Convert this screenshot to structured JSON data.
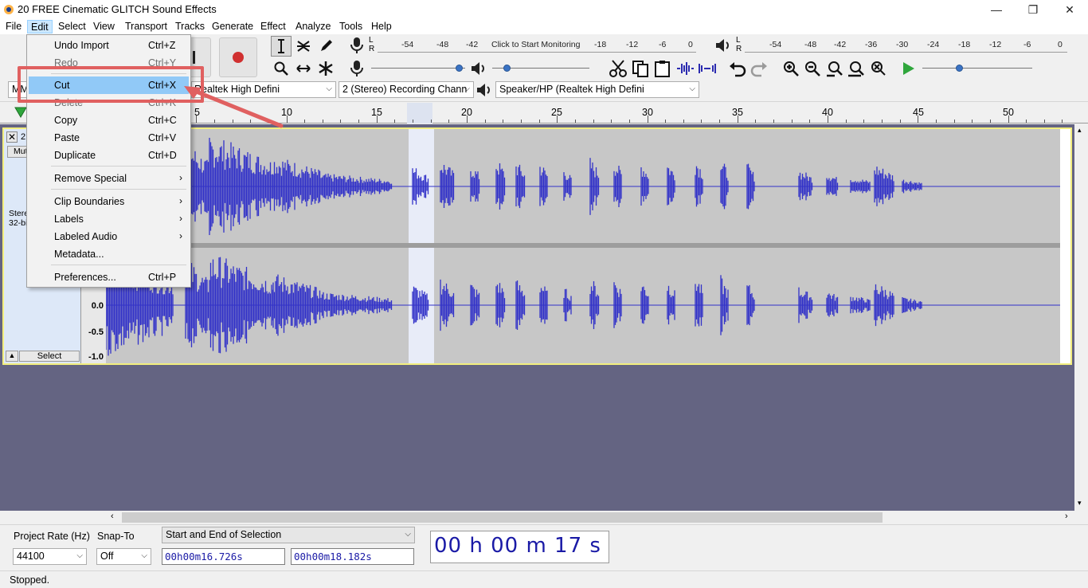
{
  "window": {
    "title": "20 FREE Cinematic GLITCH Sound Effects",
    "minimize_icon": "minimize-icon",
    "maximize_icon": "restore-icon",
    "close_icon": "close-icon"
  },
  "menubar": {
    "items": [
      "File",
      "Edit",
      "Select",
      "View",
      "Transport",
      "Tracks",
      "Generate",
      "Effect",
      "Analyze",
      "Tools",
      "Help"
    ],
    "open_menu": "Edit"
  },
  "edit_menu": {
    "items": [
      {
        "label": "Undo Import",
        "shortcut": "Ctrl+Z",
        "enabled": true
      },
      {
        "label": "Redo",
        "shortcut": "Ctrl+Y",
        "enabled": false
      },
      {
        "label": "Cut",
        "shortcut": "Ctrl+X",
        "enabled": true,
        "highlighted": true
      },
      {
        "label": "Delete",
        "shortcut": "Ctrl+K",
        "enabled": false
      },
      {
        "label": "Copy",
        "shortcut": "Ctrl+C",
        "enabled": true
      },
      {
        "label": "Paste",
        "shortcut": "Ctrl+V",
        "enabled": true
      },
      {
        "label": "Duplicate",
        "shortcut": "Ctrl+D",
        "enabled": true
      },
      {
        "label": "Remove Special",
        "shortcut": "",
        "submenu": true
      },
      {
        "label": "Clip Boundaries",
        "shortcut": "",
        "submenu": true
      },
      {
        "label": "Labels",
        "shortcut": "",
        "submenu": true
      },
      {
        "label": "Labeled Audio",
        "shortcut": "",
        "submenu": true
      },
      {
        "label": "Metadata...",
        "shortcut": ""
      },
      {
        "label": "Preferences...",
        "shortcut": "Ctrl+P"
      }
    ]
  },
  "meters": {
    "record_scale": [
      "-54",
      "-48",
      "-42",
      "Click to Start Monitoring",
      "-18",
      "-12",
      "-6",
      "0"
    ],
    "playback_scale": [
      "-54",
      "-48",
      "-42",
      "-36",
      "-30",
      "-24",
      "-18",
      "-12",
      "-6",
      "0"
    ],
    "left": "L",
    "right": "R"
  },
  "device_toolbar": {
    "host_partial": "MM",
    "recording_device": "Realtek High Defini",
    "channels": "2 (Stereo) Recording Chann",
    "playback_device": "Speaker/HP (Realtek High Defini"
  },
  "ruler": {
    "labels": [
      "5",
      "10",
      "15",
      "20",
      "25",
      "30",
      "35",
      "40",
      "45",
      "50"
    ]
  },
  "track": {
    "name_partial": "2",
    "mute_partial": "Mut",
    "info_line1": "Stere",
    "info_line2": "32-bi",
    "select_button": "Select",
    "scale_labels": [
      "0.0",
      "-0.5",
      "-1.0"
    ],
    "waveform_color": "#3232c8",
    "selection_color": "#e8ecf8"
  },
  "selection_toolbar": {
    "project_rate_label": "Project Rate (Hz)",
    "project_rate_value": "44100",
    "snap_label": "Snap-To",
    "snap_value": "Off",
    "selection_mode": "Start and End of Selection",
    "start_time": "00h00m16.726s",
    "end_time": "00h00m18.182s"
  },
  "time_toolbar": {
    "time": "00 h 00 m 17 s"
  },
  "status": {
    "text": "Stopped."
  },
  "colors": {
    "track_area_bg": "#646482",
    "highlight_box": "#e06060",
    "record_button": "#d03030",
    "play_button": "#2fa63c"
  }
}
